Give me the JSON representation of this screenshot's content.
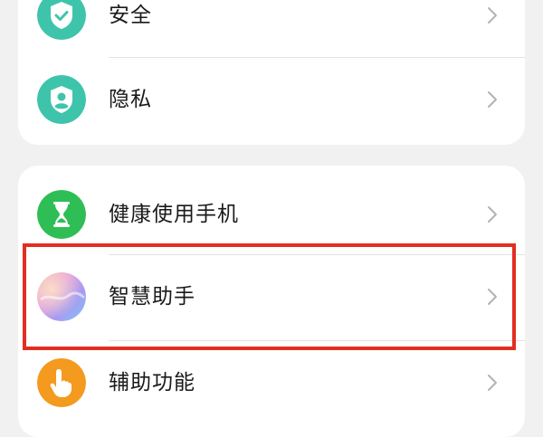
{
  "settings": {
    "group1": [
      {
        "label": "安全",
        "icon": "shield-check-icon",
        "color": "#3fc4ac"
      },
      {
        "label": "隐私",
        "icon": "privacy-shield-user-icon",
        "color": "#3fc4ac"
      }
    ],
    "group2": [
      {
        "label": "健康使用手机",
        "icon": "hourglass-icon",
        "color": "#2fbe55"
      },
      {
        "label": "智慧助手",
        "icon": "smart-assistant-gradient-icon",
        "color": "#c9a8f0"
      },
      {
        "label": "辅助功能",
        "icon": "hand-tap-icon",
        "color": "#f39a1f"
      }
    ]
  },
  "highlight": {
    "color": "#e12e22",
    "target": "智慧助手"
  }
}
